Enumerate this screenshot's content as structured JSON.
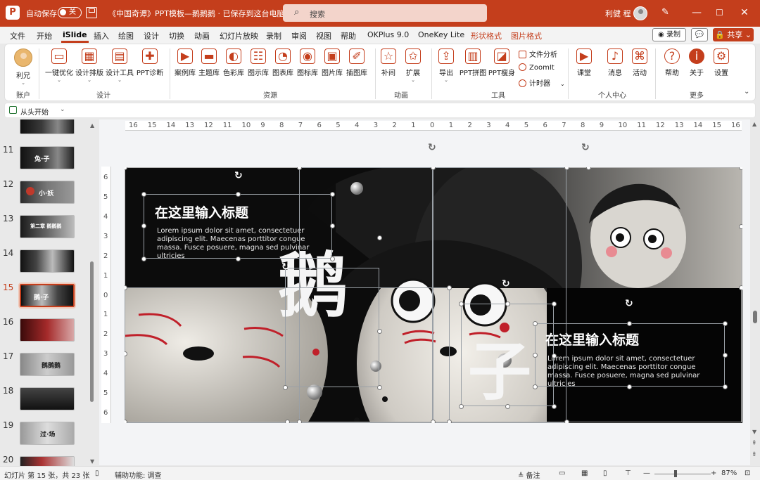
{
  "titlebar": {
    "logo": "P",
    "autosave_label": "自动保存",
    "autosave_state": "关",
    "doc_title": "《中国奇谭》PPT模板—鹅鹅鹅 · 已保存到这台电脑 ⌄",
    "search_placeholder": "搜索",
    "user_name": "利健 程",
    "min": "—",
    "max": "☐",
    "close": "✕"
  },
  "menu": {
    "tabs": [
      "文件",
      "开始",
      "iSlide",
      "插入",
      "绘图",
      "设计",
      "切换",
      "动画",
      "幻灯片放映",
      "录制",
      "审阅",
      "视图",
      "帮助",
      "OKPlus 9.0",
      "OneKey Lite",
      "形状格式",
      "图片格式"
    ],
    "record_label": "◉ 录制",
    "comment_icon": "💬",
    "share_label": "🔒 共享 ⌄"
  },
  "ribbon": {
    "account": {
      "label": "利兄",
      "group": "账户"
    },
    "design": {
      "group": "设计",
      "items": [
        "一键优化",
        "设计排版",
        "设计工具",
        "PPT诊断"
      ]
    },
    "resources": {
      "group": "资源",
      "items": [
        "案例库",
        "主题库",
        "色彩库",
        "图示库",
        "图表库",
        "图标库",
        "图片库",
        "插图库"
      ]
    },
    "animation": {
      "group": "动画",
      "items": [
        "补间",
        "扩展"
      ]
    },
    "tools": {
      "group": "工具",
      "items": [
        "导出",
        "PPT拼图",
        "PPT瘦身"
      ],
      "small": [
        "文件分析",
        "ZoomIt",
        "计时器"
      ]
    },
    "personal": {
      "group": "个人中心",
      "items": [
        "课堂",
        "消息",
        "活动"
      ]
    },
    "more": {
      "group": "更多",
      "items": [
        "帮助",
        "关于",
        "设置"
      ]
    }
  },
  "quickaccess": {
    "label": "从头开始",
    "dropdown": "⌄"
  },
  "thumbnails": [
    {
      "num": "11",
      "text": "兔·子"
    },
    {
      "num": "12",
      "text": "小·妖"
    },
    {
      "num": "13",
      "text": "第二章 鹅鹅鹅"
    },
    {
      "num": "14",
      "text": ""
    },
    {
      "num": "15",
      "text": "鹅·子",
      "selected": true
    },
    {
      "num": "16",
      "text": ""
    },
    {
      "num": "17",
      "text": "鹅鹅鹅"
    },
    {
      "num": "18",
      "text": ""
    },
    {
      "num": "19",
      "text": "过·场"
    },
    {
      "num": "20",
      "text": ""
    }
  ],
  "ruler": {
    "h": [
      "16",
      "15",
      "14",
      "13",
      "12",
      "11",
      "10",
      "9",
      "8",
      "7",
      "6",
      "5",
      "4",
      "3",
      "2",
      "1",
      "0",
      "1",
      "2",
      "3",
      "4",
      "5",
      "6",
      "7",
      "8",
      "9",
      "10",
      "11",
      "12",
      "13",
      "14",
      "15",
      "16"
    ],
    "v": [
      "6",
      "5",
      "4",
      "3",
      "2",
      "1",
      "0",
      "1",
      "2",
      "3",
      "4",
      "5",
      "6"
    ]
  },
  "slide": {
    "big_char_1": "鹅",
    "big_char_2": "子",
    "left_title": "在这里输入标题",
    "left_body": "Lorem ipsum dolor sit amet, consectetuer adipiscing elit. Maecenas porttitor congue massa. Fusce posuere, magna sed pulvinar ultricies",
    "right_title": "在这里输入标题",
    "right_body": "Lorem ipsum dolor sit amet, consectetuer adipiscing elit. Maecenas porttitor congue massa. Fusce posuere, magna sed pulvinar ultricies"
  },
  "status": {
    "slide_info": "幻灯片 第 15 张，共 23 张",
    "accessibility": "辅助功能: 调查",
    "notes": "≜ 备注",
    "zoom_minus": "—",
    "zoom_plus": "+",
    "zoom": "87%"
  },
  "colors": {
    "accent": "#c43e1c",
    "titlebar": "#c43e1c"
  }
}
